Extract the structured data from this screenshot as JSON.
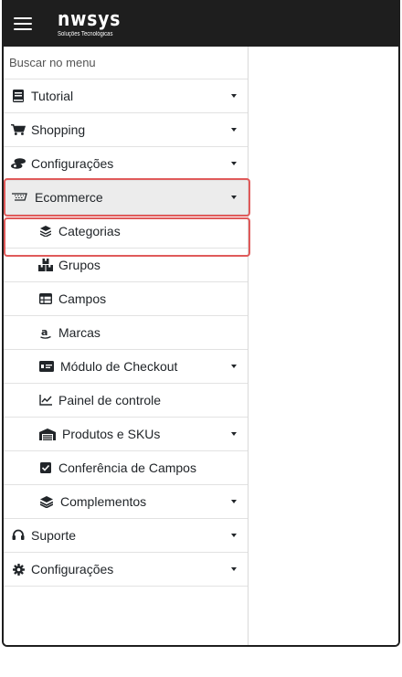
{
  "brand": {
    "name": "nwsys",
    "tagline": "Soluções Tecnológicas"
  },
  "search": {
    "placeholder": "Buscar no menu",
    "value": ""
  },
  "menu": {
    "tutorial": "Tutorial",
    "shopping": "Shopping",
    "configuracoes_1": "Configurações",
    "ecommerce": "Ecommerce",
    "categorias": "Categorias",
    "grupos": "Grupos",
    "campos": "Campos",
    "marcas": "Marcas",
    "checkout": "Módulo de Checkout",
    "painel": "Painel de controle",
    "produtos": "Produtos e SKUs",
    "conferencia": "Conferência de Campos",
    "complementos": "Complementos",
    "suporte": "Suporte",
    "configuracoes_2": "Configurações"
  },
  "colors": {
    "topbar": "#1e1e1e",
    "highlight": "#e05a5a",
    "active_bg": "#ececec"
  }
}
